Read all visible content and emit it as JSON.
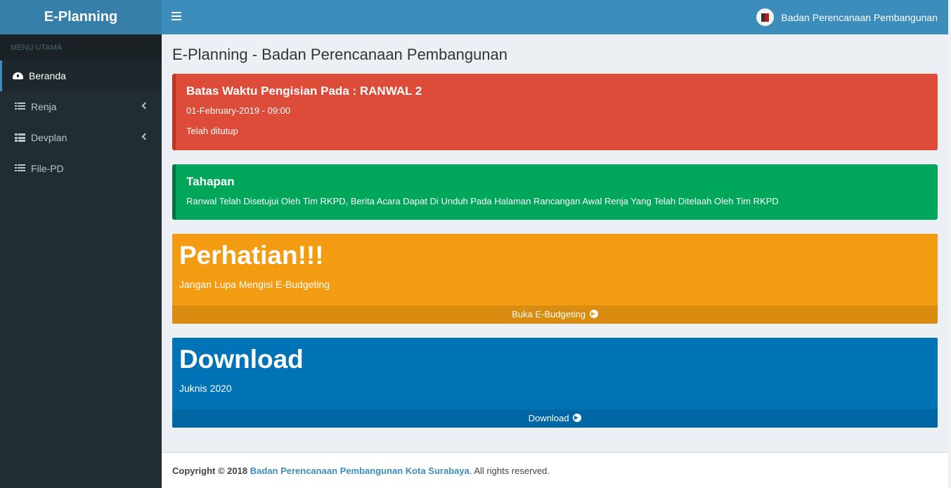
{
  "header": {
    "logo_text": "E-Planning",
    "user_name": "Badan Perencanaan Pembangunan"
  },
  "sidebar": {
    "header": "MENU UTAMA",
    "items": [
      {
        "label": "Beranda",
        "icon": "dashboard-icon",
        "active": true
      },
      {
        "label": "Renja",
        "icon": "list-icon",
        "has_submenu": true
      },
      {
        "label": "Devplan",
        "icon": "th-list-icon",
        "has_submenu": true
      },
      {
        "label": "File-PD",
        "icon": "list-icon"
      }
    ]
  },
  "main": {
    "page_title": "E-Planning - Badan Perencanaan Pembangunan",
    "callout_deadline": {
      "title": "Batas Waktu Pengisian Pada : RANWAL 2",
      "date": "01-February-2019 - 09:00",
      "status": "Telah ditutup"
    },
    "callout_tahapan": {
      "title": "Tahapan",
      "text": "Ranwal Telah Disetujui Oleh Tim RKPD, Berita Acara Dapat Di Unduh Pada Halaman Rancangan Awal Renja Yang Telah Ditelaah Oleh Tim RKPD"
    },
    "box_perhatian": {
      "title": "Perhatian!!!",
      "text": "Jangan Lupa Mengisi E-Budgeting",
      "footer_link": "Buka E-Budgeting"
    },
    "box_download": {
      "title": "Download",
      "text": "Juknis 2020",
      "footer_link": "Download"
    }
  },
  "footer": {
    "copyright": "Copyright © 2018",
    "org_link": "Badan Perencanaan Pembangunan Kota Surabaya",
    "rights": ". All rights reserved."
  },
  "colors": {
    "navbar": "#3c8dbc",
    "logo_bg": "#367fa9",
    "sidebar_bg": "#222d32",
    "danger": "#dd4b39",
    "success": "#00a65a",
    "warning": "#f39c12",
    "primary": "#0073b7"
  }
}
